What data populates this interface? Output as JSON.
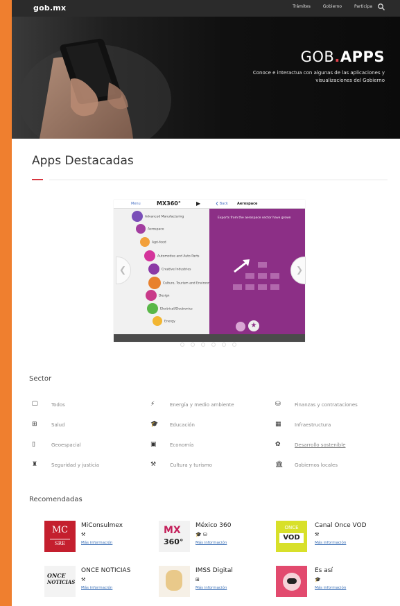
{
  "navbar": {
    "brand": "gob.mx",
    "links": [
      "Trámites",
      "Gobierno",
      "Participa"
    ],
    "search_icon": "search-icon"
  },
  "hero": {
    "title_prefix": "GOB",
    "title_dot": ".",
    "title_suffix": "APPS",
    "subtitle": "Conoce e interactua con algunas de las aplicaciones y visualizaciones del Gobierno"
  },
  "featured": {
    "title": "Apps Destacadas",
    "slide": {
      "menu": "Menu",
      "logo": "MX360°",
      "back": "Back",
      "panel_title": "Aerospace",
      "panel_text": "Exports from the aerospace sector have grown",
      "items": [
        {
          "label": "Advanced Manufacturing",
          "color": "#7a4fb8"
        },
        {
          "label": "Aerospace",
          "color": "#a33ea0"
        },
        {
          "label": "Agri-food",
          "color": "#f2a03b"
        },
        {
          "label": "Automotive and Auto Parts",
          "color": "#d4349b"
        },
        {
          "label": "Creative Industries",
          "color": "#8b3aa6"
        },
        {
          "label": "Culture, Tourism and Environment",
          "color": "#e8812e"
        },
        {
          "label": "Design",
          "color": "#c93a89"
        },
        {
          "label": "Electrical/Electronics",
          "color": "#5ab748"
        },
        {
          "label": "Energy",
          "color": "#f2b632"
        }
      ],
      "dot_count": 6,
      "active_dot": 5
    }
  },
  "sector": {
    "title": "Sector",
    "items": [
      {
        "label": "Todos",
        "icon": "monitor-icon",
        "glyph": "🖵",
        "link": false
      },
      {
        "label": "Energía y medio ambiente",
        "icon": "bolt-icon",
        "glyph": "⚡",
        "link": false
      },
      {
        "label": "Finanzas y contrataciones",
        "icon": "coins-icon",
        "glyph": "⛁",
        "link": false
      },
      {
        "label": "Salud",
        "icon": "plus-square-icon",
        "glyph": "⊞",
        "link": false
      },
      {
        "label": "Educación",
        "icon": "graduation-cap-icon",
        "glyph": "🎓",
        "link": false
      },
      {
        "label": "Infraestructura",
        "icon": "building-blocks-icon",
        "glyph": "▦",
        "link": false
      },
      {
        "label": "Geoespacial",
        "icon": "map-icon",
        "glyph": "▯",
        "link": false
      },
      {
        "label": "Economía",
        "icon": "money-icon",
        "glyph": "▣",
        "link": false
      },
      {
        "label": "Desarrollo sostenible",
        "icon": "plant-icon",
        "glyph": "✿",
        "link": true
      },
      {
        "label": "Seguridad y justicia",
        "icon": "person-icon",
        "glyph": "♜",
        "link": false
      },
      {
        "label": "Cultura y turismo",
        "icon": "pickaxe-icon",
        "glyph": "⚒",
        "link": false
      },
      {
        "label": "Gobiernos locales",
        "icon": "bank-icon",
        "glyph": "🏛",
        "link": false
      }
    ]
  },
  "recomendadas": {
    "title": "Recomendadas",
    "more_info": "Más información",
    "apps": [
      {
        "name": "MiConsulmex",
        "icons": "⚒"
      },
      {
        "name": "México 360",
        "icons": "🎓 ⛁"
      },
      {
        "name": "Canal Once VOD",
        "icons": "⚒"
      },
      {
        "name": "ONCE NOTICIAS",
        "icons": "⚒"
      },
      {
        "name": "IMSS Digital",
        "icons": "⊞"
      },
      {
        "name": "Es así",
        "icons": "🎓"
      }
    ],
    "thumbs": {
      "mc": "MC",
      "sre": "SRE",
      "mx": "MX",
      "deg": "360°",
      "once": "ONCE",
      "vod": "VOD",
      "once2": "ONCE",
      "noticias": "NOTICIAS"
    }
  }
}
